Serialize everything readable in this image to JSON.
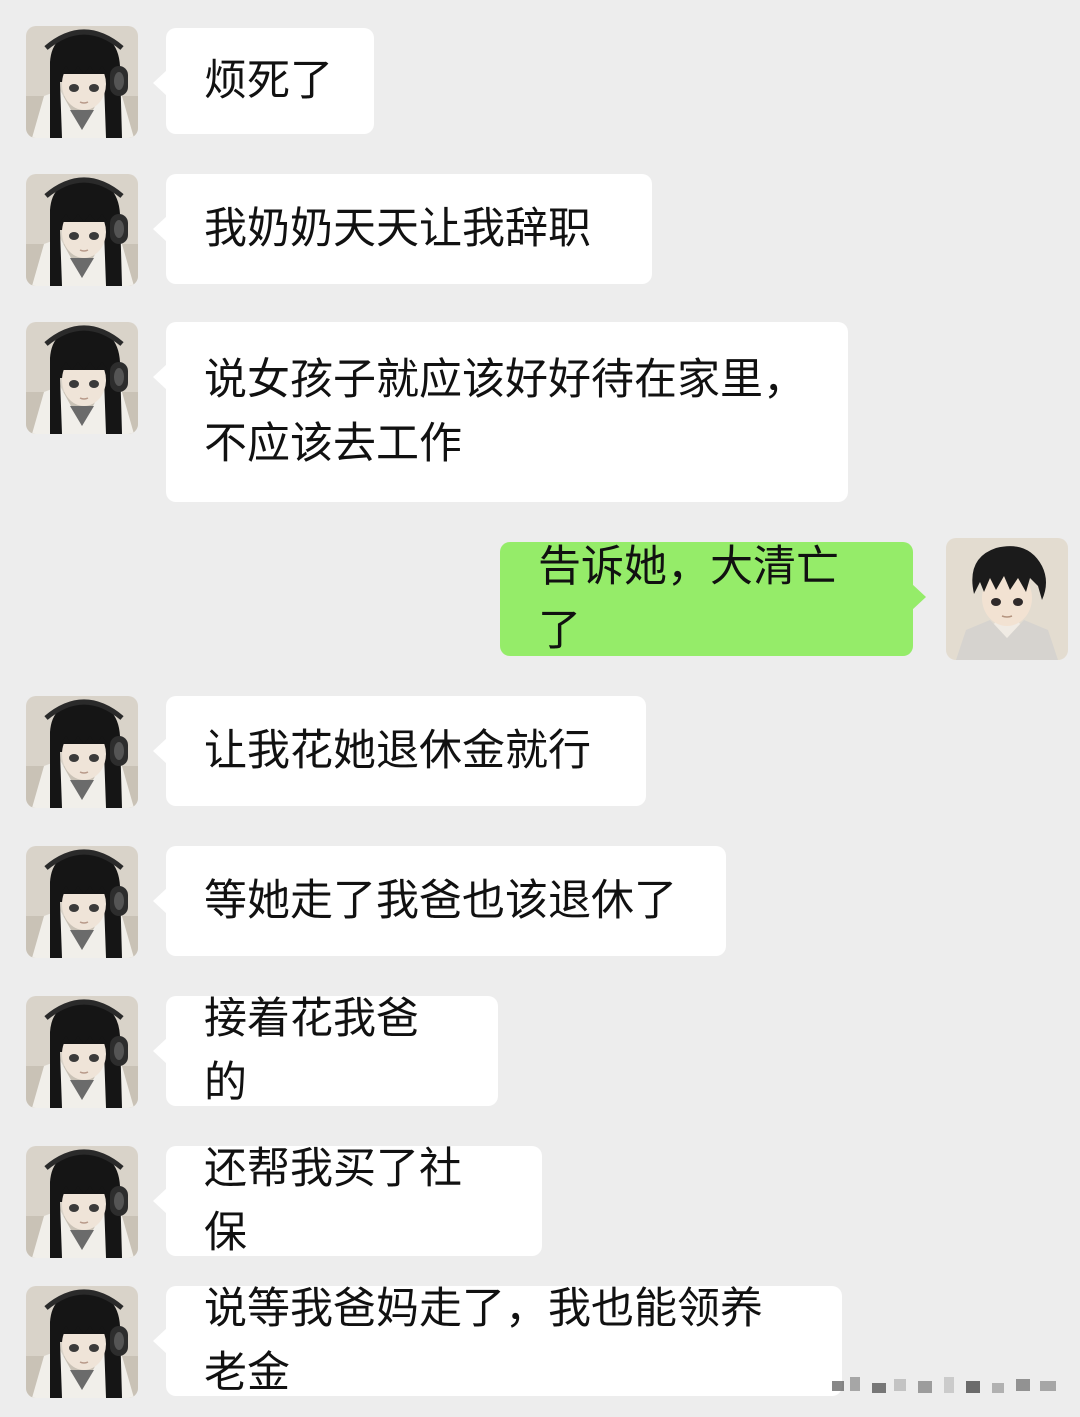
{
  "chat": {
    "messages": [
      {
        "side": "in",
        "text": "烦死了"
      },
      {
        "side": "in",
        "text": "我奶奶天天让我辞职"
      },
      {
        "side": "in",
        "text": "说女孩子就应该好好待在家里，\n不应该去工作"
      },
      {
        "side": "out",
        "text": "告诉她，大清亡了"
      },
      {
        "side": "in",
        "text": "让我花她退休金就行"
      },
      {
        "side": "in",
        "text": "等她走了我爸也该退休了"
      },
      {
        "side": "in",
        "text": "接着花我爸的"
      },
      {
        "side": "in",
        "text": "还帮我买了社保"
      },
      {
        "side": "in",
        "text": "说等我爸妈走了，我也能领养老金"
      }
    ]
  },
  "colors": {
    "background": "#ededed",
    "incoming_bubble": "#ffffff",
    "outgoing_bubble": "#95ec69"
  },
  "icons": {
    "incoming_avatar": "anime-girl-headphones-avatar",
    "outgoing_avatar": "anime-boy-avatar"
  }
}
